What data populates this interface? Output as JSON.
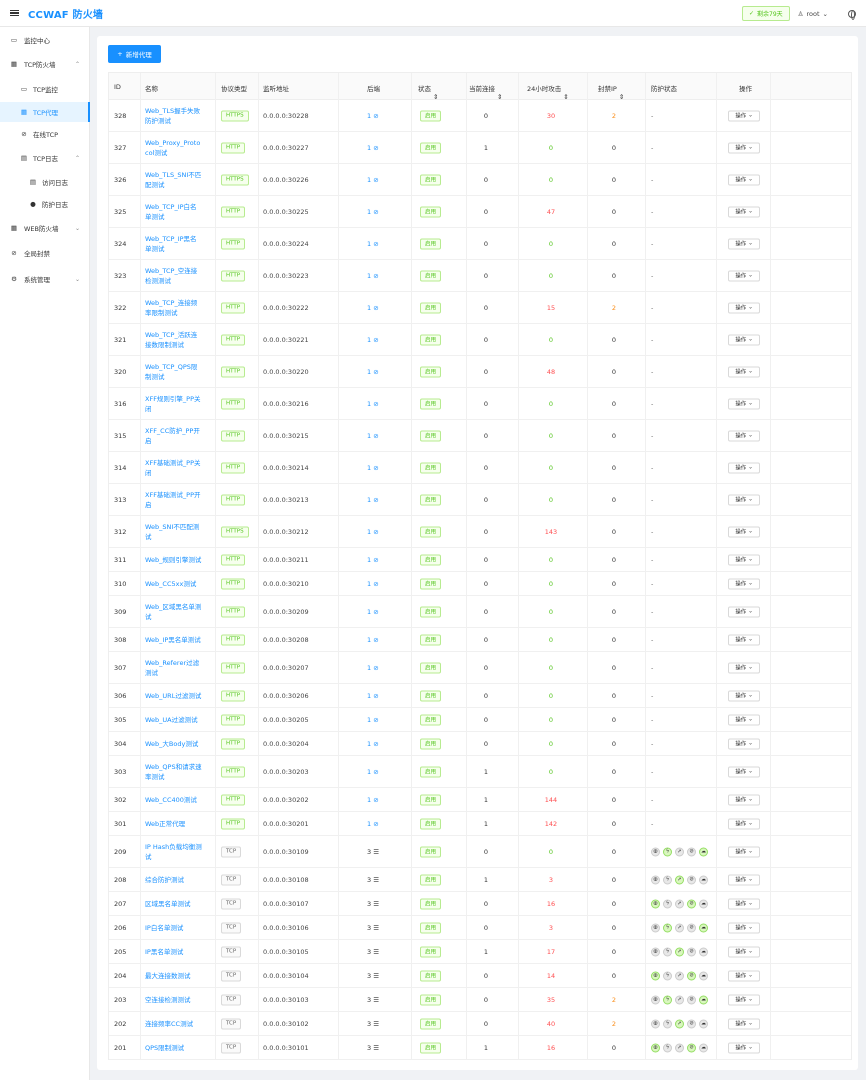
{
  "header": {
    "title": "CCWAF 防火墙",
    "days_left": "剩余79天",
    "user": "root"
  },
  "sidebar": {
    "items": [
      {
        "label": "监控中心",
        "icon": "monitor-icon",
        "arrow": ""
      },
      {
        "label": "TCP防火墙",
        "icon": "grid-icon",
        "arrow": "⌃"
      },
      {
        "label": "TCP监控",
        "icon": "monitor-icon",
        "arrow": ""
      },
      {
        "label": "TCP代理",
        "icon": "grid-icon",
        "arrow": ""
      },
      {
        "label": "在线TCP",
        "icon": "link-icon",
        "arrow": ""
      },
      {
        "label": "TCP日志",
        "icon": "doc-icon",
        "arrow": "⌃"
      },
      {
        "label": "访问日志",
        "icon": "doc-icon",
        "arrow": ""
      },
      {
        "label": "防护日志",
        "icon": "shield-icon",
        "arrow": ""
      },
      {
        "label": "WEB防火墙",
        "icon": "grid-icon",
        "arrow": "⌄"
      },
      {
        "label": "全局封禁",
        "icon": "ban-icon",
        "arrow": ""
      },
      {
        "label": "系统管理",
        "icon": "gear-icon",
        "arrow": "⌄"
      }
    ]
  },
  "toolbar": {
    "add_label": "新增代理"
  },
  "table": {
    "columns": [
      "ID",
      "名称",
      "协议类型",
      "监听地址",
      "后端",
      "状态",
      "当前连接",
      "24小时攻击",
      "封禁IP",
      "防护状态",
      "操作"
    ],
    "op_label": "操作",
    "status_label": "启用",
    "rows": [
      {
        "id": "328",
        "name": "Web_TLS握手失败防护测试",
        "proto": "HTTPS",
        "addr": "0.0.0.0:30228",
        "backend": "1",
        "conn": "0",
        "atk": "30",
        "ban": "2",
        "prot": "-"
      },
      {
        "id": "327",
        "name": "Web_Proxy_Protocol测试",
        "proto": "HTTP",
        "addr": "0.0.0.0:30227",
        "backend": "1",
        "conn": "1",
        "atk": "0",
        "ban": "0",
        "prot": "-"
      },
      {
        "id": "326",
        "name": "Web_TLS_SNI不匹配测试",
        "proto": "HTTPS",
        "addr": "0.0.0.0:30226",
        "backend": "1",
        "conn": "0",
        "atk": "0",
        "ban": "0",
        "prot": "-"
      },
      {
        "id": "325",
        "name": "Web_TCP_IP白名单测试",
        "proto": "HTTP",
        "addr": "0.0.0.0:30225",
        "backend": "1",
        "conn": "0",
        "atk": "47",
        "ban": "0",
        "prot": "-"
      },
      {
        "id": "324",
        "name": "Web_TCP_IP黑名单测试",
        "proto": "HTTP",
        "addr": "0.0.0.0:30224",
        "backend": "1",
        "conn": "0",
        "atk": "0",
        "ban": "0",
        "prot": "-"
      },
      {
        "id": "323",
        "name": "Web_TCP_空连接检测测试",
        "proto": "HTTP",
        "addr": "0.0.0.0:30223",
        "backend": "1",
        "conn": "0",
        "atk": "0",
        "ban": "0",
        "prot": "-"
      },
      {
        "id": "322",
        "name": "Web_TCP_连接频率限制测试",
        "proto": "HTTP",
        "addr": "0.0.0.0:30222",
        "backend": "1",
        "conn": "0",
        "atk": "15",
        "ban": "2",
        "prot": "-"
      },
      {
        "id": "321",
        "name": "Web_TCP_活跃连接数限制测试",
        "proto": "HTTP",
        "addr": "0.0.0.0:30221",
        "backend": "1",
        "conn": "0",
        "atk": "0",
        "ban": "0",
        "prot": "-"
      },
      {
        "id": "320",
        "name": "Web_TCP_QPS限制测试",
        "proto": "HTTP",
        "addr": "0.0.0.0:30220",
        "backend": "1",
        "conn": "0",
        "atk": "48",
        "ban": "0",
        "prot": "-"
      },
      {
        "id": "316",
        "name": "XFF规则引擎_PP关闭",
        "proto": "HTTP",
        "addr": "0.0.0.0:30216",
        "backend": "1",
        "conn": "0",
        "atk": "0",
        "ban": "0",
        "prot": "-"
      },
      {
        "id": "315",
        "name": "XFF_CC防护_PP开启",
        "proto": "HTTP",
        "addr": "0.0.0.0:30215",
        "backend": "1",
        "conn": "0",
        "atk": "0",
        "ban": "0",
        "prot": "-"
      },
      {
        "id": "314",
        "name": "XFF基础测试_PP关闭",
        "proto": "HTTP",
        "addr": "0.0.0.0:30214",
        "backend": "1",
        "conn": "0",
        "atk": "0",
        "ban": "0",
        "prot": "-"
      },
      {
        "id": "313",
        "name": "XFF基础测试_PP开启",
        "proto": "HTTP",
        "addr": "0.0.0.0:30213",
        "backend": "1",
        "conn": "0",
        "atk": "0",
        "ban": "0",
        "prot": "-"
      },
      {
        "id": "312",
        "name": "Web_SNI不匹配测试",
        "proto": "HTTPS",
        "addr": "0.0.0.0:30212",
        "backend": "1",
        "conn": "0",
        "atk": "143",
        "ban": "0",
        "prot": "-"
      },
      {
        "id": "311",
        "name": "Web_规则引擎测试",
        "proto": "HTTP",
        "addr": "0.0.0.0:30211",
        "backend": "1",
        "conn": "0",
        "atk": "0",
        "ban": "0",
        "prot": "-"
      },
      {
        "id": "310",
        "name": "Web_CC5xx测试",
        "proto": "HTTP",
        "addr": "0.0.0.0:30210",
        "backend": "1",
        "conn": "0",
        "atk": "0",
        "ban": "0",
        "prot": "-"
      },
      {
        "id": "309",
        "name": "Web_区域黑名单测试",
        "proto": "HTTP",
        "addr": "0.0.0.0:30209",
        "backend": "1",
        "conn": "0",
        "atk": "0",
        "ban": "0",
        "prot": "-"
      },
      {
        "id": "308",
        "name": "Web_IP黑名单测试",
        "proto": "HTTP",
        "addr": "0.0.0.0:30208",
        "backend": "1",
        "conn": "0",
        "atk": "0",
        "ban": "0",
        "prot": "-"
      },
      {
        "id": "307",
        "name": "Web_Referer过滤测试",
        "proto": "HTTP",
        "addr": "0.0.0.0:30207",
        "backend": "1",
        "conn": "0",
        "atk": "0",
        "ban": "0",
        "prot": "-"
      },
      {
        "id": "306",
        "name": "Web_URL过滤测试",
        "proto": "HTTP",
        "addr": "0.0.0.0:30206",
        "backend": "1",
        "conn": "0",
        "atk": "0",
        "ban": "0",
        "prot": "-"
      },
      {
        "id": "305",
        "name": "Web_UA过滤测试",
        "proto": "HTTP",
        "addr": "0.0.0.0:30205",
        "backend": "1",
        "conn": "0",
        "atk": "0",
        "ban": "0",
        "prot": "-"
      },
      {
        "id": "304",
        "name": "Web_大Body测试",
        "proto": "HTTP",
        "addr": "0.0.0.0:30204",
        "backend": "1",
        "conn": "0",
        "atk": "0",
        "ban": "0",
        "prot": "-"
      },
      {
        "id": "303",
        "name": "Web_QPS和请求速率测试",
        "proto": "HTTP",
        "addr": "0.0.0.0:30203",
        "backend": "1",
        "conn": "1",
        "atk": "0",
        "ban": "0",
        "prot": "-"
      },
      {
        "id": "302",
        "name": "Web_CC400测试",
        "proto": "HTTP",
        "addr": "0.0.0.0:30202",
        "backend": "1",
        "conn": "1",
        "atk": "144",
        "ban": "0",
        "prot": "-"
      },
      {
        "id": "301",
        "name": "Web正常代理",
        "proto": "HTTP",
        "addr": "0.0.0.0:30201",
        "backend": "1",
        "conn": "1",
        "atk": "142",
        "ban": "0",
        "prot": "-"
      },
      {
        "id": "209",
        "name": "IP Hash负载均衡测试",
        "proto": "TCP",
        "addr": "0.0.0.0:30109",
        "backend": "3",
        "conn": "0",
        "atk": "0",
        "ban": "0",
        "prot": "icons"
      },
      {
        "id": "208",
        "name": "综合防护测试",
        "proto": "TCP",
        "addr": "0.0.0.0:30108",
        "backend": "3",
        "conn": "1",
        "atk": "3",
        "ban": "0",
        "prot": "icons"
      },
      {
        "id": "207",
        "name": "区域黑名单测试",
        "proto": "TCP",
        "addr": "0.0.0.0:30107",
        "backend": "3",
        "conn": "0",
        "atk": "16",
        "ban": "0",
        "prot": "icons"
      },
      {
        "id": "206",
        "name": "IP白名单测试",
        "proto": "TCP",
        "addr": "0.0.0.0:30106",
        "backend": "3",
        "conn": "0",
        "atk": "3",
        "ban": "0",
        "prot": "icons"
      },
      {
        "id": "205",
        "name": "IP黑名单测试",
        "proto": "TCP",
        "addr": "0.0.0.0:30105",
        "backend": "3",
        "conn": "1",
        "atk": "17",
        "ban": "0",
        "prot": "icons"
      },
      {
        "id": "204",
        "name": "最大连接数测试",
        "proto": "TCP",
        "addr": "0.0.0.0:30104",
        "backend": "3",
        "conn": "0",
        "atk": "14",
        "ban": "0",
        "prot": "icons"
      },
      {
        "id": "203",
        "name": "空连接检测测试",
        "proto": "TCP",
        "addr": "0.0.0.0:30103",
        "backend": "3",
        "conn": "0",
        "atk": "35",
        "ban": "2",
        "prot": "icons"
      },
      {
        "id": "202",
        "name": "连接频率CC测试",
        "proto": "TCP",
        "addr": "0.0.0.0:30102",
        "backend": "3",
        "conn": "0",
        "atk": "40",
        "ban": "2",
        "prot": "icons"
      },
      {
        "id": "201",
        "name": "QPS限制测试",
        "proto": "TCP",
        "addr": "0.0.0.0:30101",
        "backend": "3",
        "conn": "1",
        "atk": "16",
        "ban": "0",
        "prot": "icons"
      }
    ]
  },
  "protection_icons": [
    "globe-icon",
    "bolt-icon",
    "rocket-icon",
    "link-icon",
    "cloud-icon"
  ],
  "colors": {
    "primary": "#1890ff",
    "success": "#52c41a",
    "danger": "#ff4d4f",
    "warning": "#fa8c16"
  }
}
